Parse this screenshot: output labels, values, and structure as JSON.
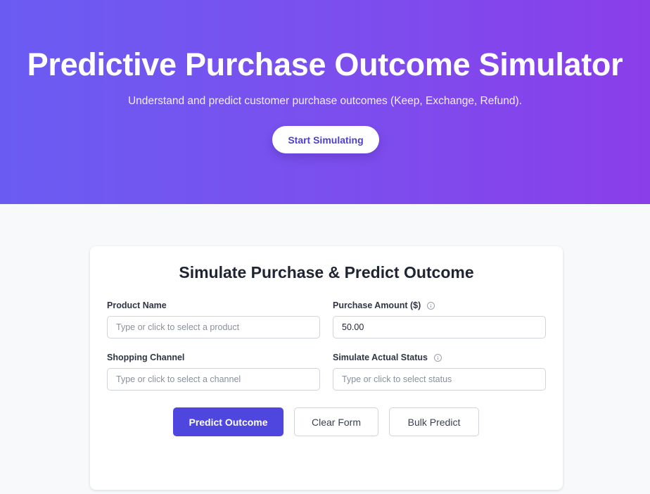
{
  "hero": {
    "title": "Predictive Purchase Outcome Simulator",
    "subtitle": "Understand and predict customer purchase outcomes (Keep, Exchange, Refund).",
    "cta_label": "Start Simulating"
  },
  "form": {
    "title": "Simulate Purchase & Predict Outcome",
    "product_name": {
      "label": "Product Name",
      "value": "",
      "placeholder": "Type or click to select a product"
    },
    "purchase_amount": {
      "label": "Purchase Amount ($)",
      "value": "50.00",
      "placeholder": ""
    },
    "shopping_channel": {
      "label": "Shopping Channel",
      "value": "",
      "placeholder": "Type or click to select a channel"
    },
    "actual_status": {
      "label": "Simulate Actual Status",
      "value": "",
      "placeholder": "Type or click to select status"
    },
    "buttons": {
      "predict": "Predict Outcome",
      "clear": "Clear Form",
      "bulk": "Bulk Predict"
    }
  },
  "colors": {
    "gradient_start": "#6a5cf2",
    "gradient_end": "#8a3eea",
    "primary": "#4f46e0",
    "background": "#f8f9fb"
  },
  "icons": {
    "info": "info-circle-icon"
  }
}
